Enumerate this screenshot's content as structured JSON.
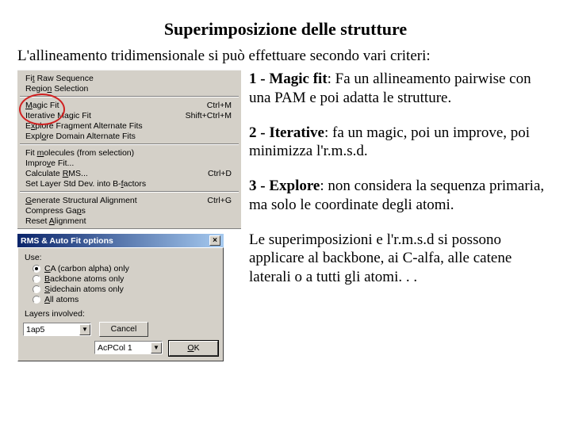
{
  "title": "Superimposizione delle strutture",
  "intro": "L'allineamento tridimensionale si può effettuare secondo vari criteri:",
  "menu": {
    "sec1": [
      {
        "label_html": "Fi<u>t</u> Raw Sequence",
        "shortcut": ""
      },
      {
        "label_html": "Regio<u>n</u> Selection",
        "shortcut": ""
      }
    ],
    "sec2": [
      {
        "label_html": "<u>M</u>agic Fit",
        "shortcut": "Ctrl+M"
      },
      {
        "label_html": "Iterative Ma<u>g</u>ic Fit",
        "shortcut": "Shift+Ctrl+M"
      },
      {
        "label_html": "E<u>x</u>plore Fragment Alternate Fits",
        "shortcut": ""
      },
      {
        "label_html": "Expl<u>o</u>re Domain Alternate Fits",
        "shortcut": ""
      }
    ],
    "sec3": [
      {
        "label_html": "Fit <u>m</u>olecules (from selection)",
        "shortcut": ""
      },
      {
        "label_html": "Impro<u>v</u>e Fit...",
        "shortcut": ""
      },
      {
        "label_html": "Calculate <u>R</u>MS...",
        "shortcut": "Ctrl+D"
      },
      {
        "label_html": "Set Layer Std Dev. into B-<u>f</u>actors",
        "shortcut": ""
      }
    ],
    "sec4": [
      {
        "label_html": "<u>G</u>enerate Structural Alignment",
        "shortcut": "Ctrl+G"
      },
      {
        "label_html": "Compress Ga<u>p</u>s",
        "shortcut": ""
      },
      {
        "label_html": "Reset <u>A</u>lignment",
        "shortcut": ""
      }
    ]
  },
  "dialog": {
    "title": "RMS & Auto Fit options",
    "use_label": "Use:",
    "radios": [
      {
        "label_html": "<u>C</u>A (carbon alpha) only",
        "selected": true
      },
      {
        "label_html": "<u>B</u>ackbone atoms only",
        "selected": false
      },
      {
        "label_html": "<u>S</u>idechain atoms only",
        "selected": false
      },
      {
        "label_html": "<u>A</u>ll atoms",
        "selected": false
      }
    ],
    "layers_label": "Layers involved:",
    "combo1": "1ap5",
    "combo2": "AcPCol 1",
    "cancel": "Cancel",
    "ok": "OK"
  },
  "desc": {
    "p1_lead": "1 - Magic fit",
    "p1_rest": ": Fa un allineamento pairwise con una PAM e poi adatta le strutture.",
    "p2_lead": "2 - Iterative",
    "p2_rest": ": fa un magic, poi un improve, poi minimizza l'r.m.s.d.",
    "p3_lead": "3 - Explore",
    "p3_rest": ": non considera la sequenza primaria, ma solo le coordinate degli atomi.",
    "p4": "Le superimposizioni e l'r.m.s.d si possono applicare al backbone, ai C-alfa, alle catene laterali o a tutti gli atomi. . ."
  }
}
